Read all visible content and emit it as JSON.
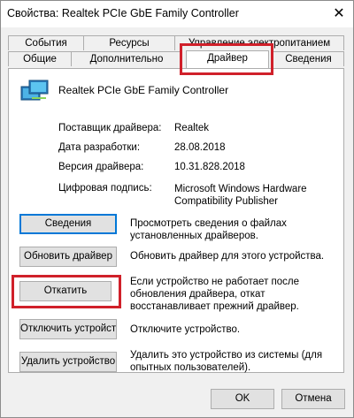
{
  "window": {
    "title": "Свойства: Realtek PCIe GbE Family Controller",
    "close_symbol": "✕"
  },
  "tabs": {
    "row1": [
      "События",
      "Ресурсы",
      "Управление электропитанием"
    ],
    "row2": [
      "Общие",
      "Дополнительно",
      "Драйвер",
      "Сведения"
    ],
    "active": "Драйвер"
  },
  "device": {
    "icon": "network-adapter-icon",
    "name": "Realtek PCIe GbE Family Controller"
  },
  "props": [
    {
      "label": "Поставщик драйвера:",
      "value": "Realtek"
    },
    {
      "label": "Дата разработки:",
      "value": "28.08.2018"
    },
    {
      "label": "Версия драйвера:",
      "value": "10.31.828.2018"
    },
    {
      "label": "Цифровая подпись:",
      "value": "Microsoft Windows Hardware Compatibility Publisher"
    }
  ],
  "actions": [
    {
      "button": "Сведения",
      "desc": "Просмотреть сведения о файлах установленных драйверов."
    },
    {
      "button": "Обновить драйвер",
      "desc": "Обновить драйвер для этого устройства."
    },
    {
      "button": "Откатить",
      "desc": "Если устройство не работает после обновления драйвера, откат восстанавливает прежний драйвер."
    },
    {
      "button": "Отключить устройство",
      "desc": "Отключите устройство."
    },
    {
      "button": "Удалить устройство",
      "desc": "Удалить это устройство из системы (для опытных пользователей)."
    }
  ],
  "footer": {
    "ok": "OK",
    "cancel": "Отмена"
  },
  "colors": {
    "highlight": "#d0202a",
    "focus": "#0078d7"
  }
}
